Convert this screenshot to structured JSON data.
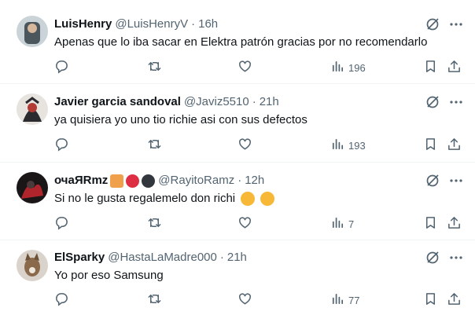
{
  "tweets": [
    {
      "name": "LuisHenry",
      "handle": "@LuisHenryV",
      "separator": "·",
      "time": "16h",
      "text": "Apenas que lo iba sacar en Elektra patrón gracias por no recomendarlo",
      "views": "196",
      "avatar_colors": [
        "#c9d3d8",
        "#4b565c"
      ]
    },
    {
      "name": "Javier garcia sandoval",
      "handle": "@Javiz5510",
      "separator": "·",
      "time": "21h",
      "text": "ya quisiera yo uno tio richie asi con sus defectos",
      "views": "193",
      "avatar_colors": [
        "#2b2a2e",
        "#b33b36"
      ]
    },
    {
      "name": "очаЯRmz",
      "handle": "@RayitoRamz",
      "separator": "·",
      "time": "12h",
      "text": "Si no le gusta regalemelo don richi",
      "views": "7",
      "avatar_colors": [
        "#1a1517",
        "#b0252b"
      ],
      "name_emojis": [
        "#f0a04b",
        "#dd2e44",
        "#31373d"
      ],
      "text_emojis": [
        "#f7b838",
        "#f7b838"
      ]
    },
    {
      "name": "ElSparky",
      "handle": "@HastaLaMadre000",
      "separator": "·",
      "time": "21h",
      "text": "Yo por eso Samsung",
      "views": "77",
      "avatar_colors": [
        "#d9d3cc",
        "#8a6a4a"
      ]
    }
  ],
  "icons": {
    "reply": "reply-icon",
    "repost": "repost-icon",
    "like": "like-icon",
    "views": "views-icon",
    "bookmark": "bookmark-icon",
    "share": "share-icon",
    "grok": "grok-icon",
    "more": "more-icon"
  },
  "colors": {
    "text_primary": "#0f1419",
    "text_secondary": "#536471",
    "divider": "#eff3f4"
  }
}
